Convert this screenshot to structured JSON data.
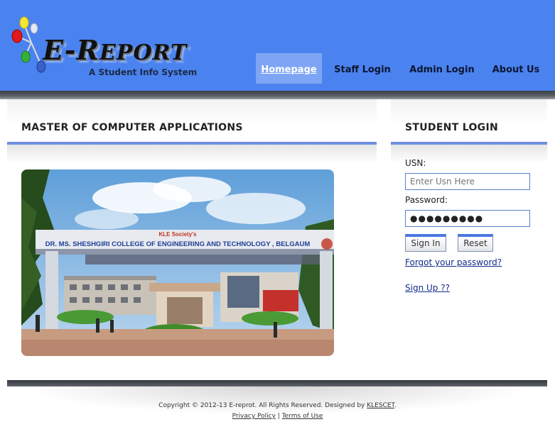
{
  "header": {
    "logo_title_big": "E-R",
    "logo_title_small": "EPORT",
    "tagline": "A Student Info System",
    "nav": [
      {
        "label": "Homepage",
        "active": true
      },
      {
        "label": "Staff Login",
        "active": false
      },
      {
        "label": "Admin Login",
        "active": false
      },
      {
        "label": "About Us",
        "active": false
      }
    ]
  },
  "main": {
    "title": "MASTER OF COMPUTER APPLICATIONS",
    "campus_sign_top": "KLE Society's",
    "campus_sign_main": "DR. MS. SHESHGIRI COLLEGE OF ENGINEERING AND TECHNOLOGY , BELGAUM"
  },
  "login": {
    "title": "STUDENT LOGIN",
    "usn_label": "USN:",
    "usn_placeholder": "Enter Usn Here",
    "password_label": "Password:",
    "password_value": "●●●●●●●●●",
    "sign_in": "Sign In",
    "reset": "Reset",
    "forgot": "Forgot your password?",
    "signup": "Sign Up ??"
  },
  "footer": {
    "copyright_prefix": "Copyright © 2012-13 E-reprot. All Rights Reserved. Designed by ",
    "designer": "KLESCET",
    "copyright_suffix": ".",
    "privacy": "Privacy Policy",
    "separator": "|",
    "terms": "Terms of Use"
  },
  "colors": {
    "header_blue": "#4a82ef",
    "nav_active": "#7ea5f4",
    "rule_blue": "#6e8fe0",
    "link_blue": "#102c8a"
  }
}
